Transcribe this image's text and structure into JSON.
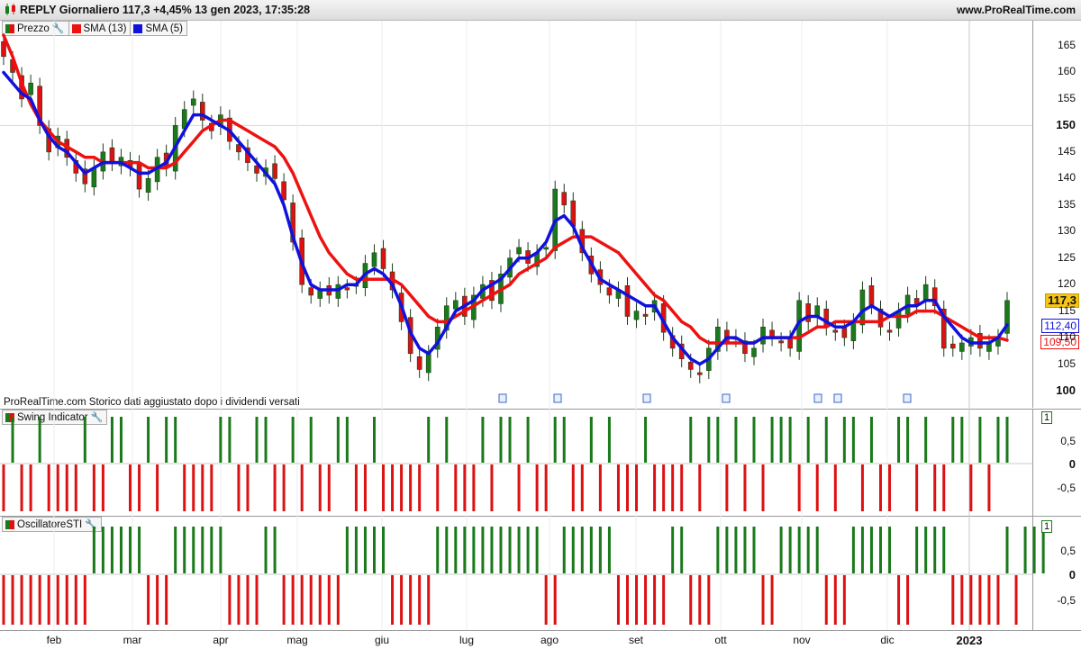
{
  "window": {
    "title": "REPLY Giornaliero 117,3 +4,45% 13 gen 2023, 17:35:28",
    "website": "www.ProRealTime.com"
  },
  "legend": {
    "price": "Prezzo",
    "sma13": "SMA (13)",
    "sma5": "SMA (5)",
    "swing": "Swing Indicator",
    "sti": "OscillatoreSTI"
  },
  "note": "ProRealTime.com Storico dati aggiustato dopo i dividendi versati",
  "colors": {
    "up": "#1a7a1a",
    "down": "#dd1111",
    "sma13": "#ee1111",
    "sma5": "#1111dd",
    "last_tag": "#f5c518"
  },
  "price_tags": {
    "last": "117,3",
    "sma5": "112,40",
    "sma13": "109,50"
  },
  "indicator_axis": {
    "one": "1",
    "half": "0,5",
    "zero": "0",
    "neg_half": "-0,5"
  },
  "chart_data": [
    {
      "type": "candlestick",
      "title": "REPLY Giornaliero",
      "ylim": [
        99,
        168
      ],
      "y_ticks": [
        "165",
        "160",
        "155",
        "150",
        "145",
        "140",
        "135",
        "130",
        "125",
        "120",
        "115",
        "110",
        "105",
        "100"
      ],
      "x_ticks": [
        "feb",
        "mar",
        "apr",
        "mag",
        "giu",
        "lug",
        "ago",
        "set",
        "ott",
        "nov",
        "dic",
        "2023"
      ],
      "closes": [
        163,
        160,
        155,
        158,
        150,
        145,
        148,
        144,
        141,
        139,
        142,
        145,
        143,
        144,
        142,
        138,
        140,
        144,
        142,
        150,
        153,
        155,
        151,
        149,
        152,
        147,
        145,
        143,
        141,
        142,
        140,
        136,
        128,
        120,
        118,
        119,
        118,
        120,
        119,
        120,
        124,
        126,
        123,
        119,
        113,
        107,
        104,
        107,
        112,
        116,
        117,
        114,
        118,
        120,
        117,
        122,
        125,
        127,
        124,
        126,
        127,
        138,
        135,
        131,
        126,
        122,
        120,
        118,
        119,
        114,
        115,
        114,
        117,
        111,
        108,
        106,
        104,
        103,
        108,
        112,
        109,
        110,
        107,
        108,
        112,
        110,
        109,
        108,
        117,
        113,
        116,
        112,
        111,
        110,
        113,
        119,
        116,
        112,
        111,
        115,
        118,
        116,
        120,
        116,
        108,
        108,
        109,
        110,
        108,
        109,
        110,
        117
      ],
      "sma13": [
        167,
        163,
        158,
        154,
        151,
        149,
        147,
        146,
        145,
        144,
        144,
        143,
        143,
        143,
        143,
        143,
        142,
        142,
        142,
        143,
        145,
        147,
        149,
        150,
        151,
        151,
        150,
        149,
        148,
        147,
        146,
        144,
        141,
        137,
        133,
        129,
        126,
        124,
        122,
        121,
        121,
        121,
        121,
        121,
        120,
        118,
        116,
        114,
        113,
        113,
        114,
        115,
        116,
        117,
        118,
        119,
        120,
        122,
        123,
        124,
        125,
        127,
        128,
        129,
        129,
        129,
        128,
        127,
        126,
        124,
        122,
        120,
        118,
        117,
        115,
        113,
        112,
        110,
        109,
        109,
        109,
        109,
        109,
        109,
        110,
        110,
        110,
        110,
        110,
        111,
        112,
        112,
        113,
        113,
        113,
        113,
        113,
        113,
        114,
        114,
        114,
        115,
        115,
        115,
        114,
        113,
        112,
        111,
        110,
        110,
        110,
        109.5
      ],
      "sma5": [
        160,
        158,
        156,
        155,
        151,
        148,
        146,
        145,
        143,
        141,
        142,
        143,
        143,
        143,
        142,
        141,
        141,
        142,
        143,
        146,
        149,
        152,
        152,
        151,
        150,
        149,
        147,
        145,
        143,
        141,
        139,
        135,
        129,
        124,
        120,
        119,
        119,
        119,
        120,
        120,
        122,
        123,
        122,
        120,
        116,
        111,
        108,
        107,
        109,
        112,
        115,
        116,
        117,
        119,
        120,
        121,
        123,
        125,
        125,
        126,
        128,
        132,
        133,
        131,
        127,
        124,
        121,
        120,
        119,
        118,
        117,
        116,
        116,
        113,
        110,
        108,
        106,
        105,
        106,
        108,
        110,
        110,
        109,
        109,
        110,
        110,
        110,
        110,
        113,
        114,
        114,
        113,
        112,
        112,
        113,
        115,
        116,
        115,
        114,
        115,
        116,
        116,
        117,
        117,
        114,
        112,
        110,
        109,
        109,
        109,
        110,
        112.4
      ],
      "last_price": 117.3
    },
    {
      "type": "bar",
      "title": "Swing Indicator",
      "ylim": [
        -1,
        1
      ],
      "values": [
        -1,
        1,
        -1,
        -1,
        1,
        -1,
        -1,
        -1,
        -1,
        1,
        -1,
        -1,
        1,
        1,
        -1,
        -1,
        1,
        -1,
        1,
        1,
        -1,
        -1,
        -1,
        -1,
        1,
        1,
        -1,
        -1,
        1,
        1,
        -1,
        -1,
        1,
        -1,
        1,
        -1,
        -1,
        1,
        1,
        -1,
        -1,
        1,
        -1,
        -1,
        -1,
        -1,
        -1,
        1,
        -1,
        1,
        -1,
        -1,
        -1,
        1,
        -1,
        1,
        1,
        -1,
        1,
        -1,
        -1,
        1,
        1,
        -1,
        -1,
        1,
        -1,
        1,
        -1,
        -1,
        -1,
        1,
        -1,
        -1,
        -1,
        -1,
        1,
        -1,
        1,
        1,
        -1,
        1,
        -1,
        1,
        -1,
        1,
        1,
        1,
        -1,
        1,
        -1,
        1,
        -1,
        1,
        1,
        -1,
        1,
        -1,
        -1,
        1,
        1,
        -1,
        1,
        -1,
        -1,
        1,
        1,
        -1,
        1,
        -1,
        1,
        1
      ]
    },
    {
      "type": "bar",
      "title": "OscillatoreSTI",
      "ylim": [
        -1,
        1
      ],
      "values": [
        -1,
        -1,
        -1,
        -1,
        -1,
        -1,
        -1,
        -1,
        -1,
        -1,
        1,
        1,
        1,
        1,
        1,
        1,
        -1,
        -1,
        -1,
        1,
        1,
        1,
        1,
        1,
        1,
        -1,
        -1,
        -1,
        -1,
        1,
        1,
        -1,
        -1,
        -1,
        -1,
        -1,
        -1,
        -1,
        1,
        1,
        1,
        1,
        1,
        -1,
        -1,
        -1,
        -1,
        -1,
        1,
        1,
        1,
        1,
        1,
        1,
        1,
        1,
        1,
        1,
        1,
        1,
        -1,
        -1,
        1,
        1,
        1,
        1,
        1,
        1,
        -1,
        -1,
        -1,
        -1,
        -1,
        -1,
        1,
        1,
        -1,
        -1,
        -1,
        1,
        1,
        1,
        1,
        1,
        -1,
        -1,
        1,
        1,
        1,
        1,
        1,
        -1,
        -1,
        -1,
        1,
        1,
        1,
        1,
        1,
        -1,
        -1,
        1,
        1,
        1,
        1,
        -1,
        -1,
        -1,
        -1,
        -1,
        -1,
        1,
        -1,
        1,
        1,
        1
      ]
    }
  ]
}
